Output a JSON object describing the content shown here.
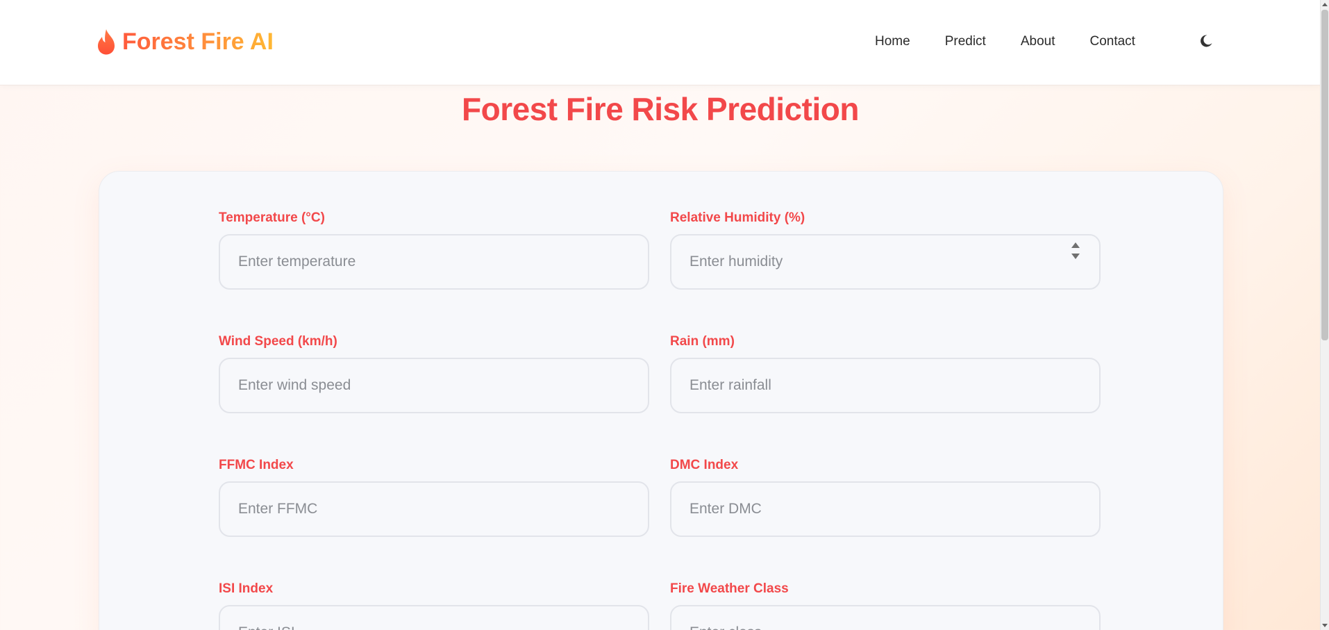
{
  "brand": {
    "name": "Forest Fire AI",
    "icon": "flame-icon",
    "gradient": [
      "#ff5a3c",
      "#ff8a3c",
      "#ffb833"
    ]
  },
  "nav": {
    "items": [
      {
        "label": "Home"
      },
      {
        "label": "Predict"
      },
      {
        "label": "About"
      },
      {
        "label": "Contact"
      }
    ],
    "theme_toggle_icon": "moon-icon"
  },
  "page": {
    "title": "Forest Fire Risk Prediction",
    "accent_color": "#f2484a"
  },
  "form": {
    "fields": [
      {
        "label": "Temperature (°C)",
        "placeholder": "Enter temperature",
        "value": ""
      },
      {
        "label": "Relative Humidity (%)",
        "placeholder": "Enter humidity",
        "value": ""
      },
      {
        "label": "Wind Speed (km/h)",
        "placeholder": "Enter wind speed",
        "value": ""
      },
      {
        "label": "Rain (mm)",
        "placeholder": "Enter rainfall",
        "value": ""
      },
      {
        "label": "FFMC Index",
        "placeholder": "Enter FFMC",
        "value": ""
      },
      {
        "label": "DMC Index",
        "placeholder": "Enter DMC",
        "value": ""
      },
      {
        "label": "ISI Index",
        "placeholder": "Enter ISI",
        "value": ""
      },
      {
        "label": "Fire Weather Class",
        "placeholder": "Enter class",
        "value": ""
      }
    ]
  }
}
